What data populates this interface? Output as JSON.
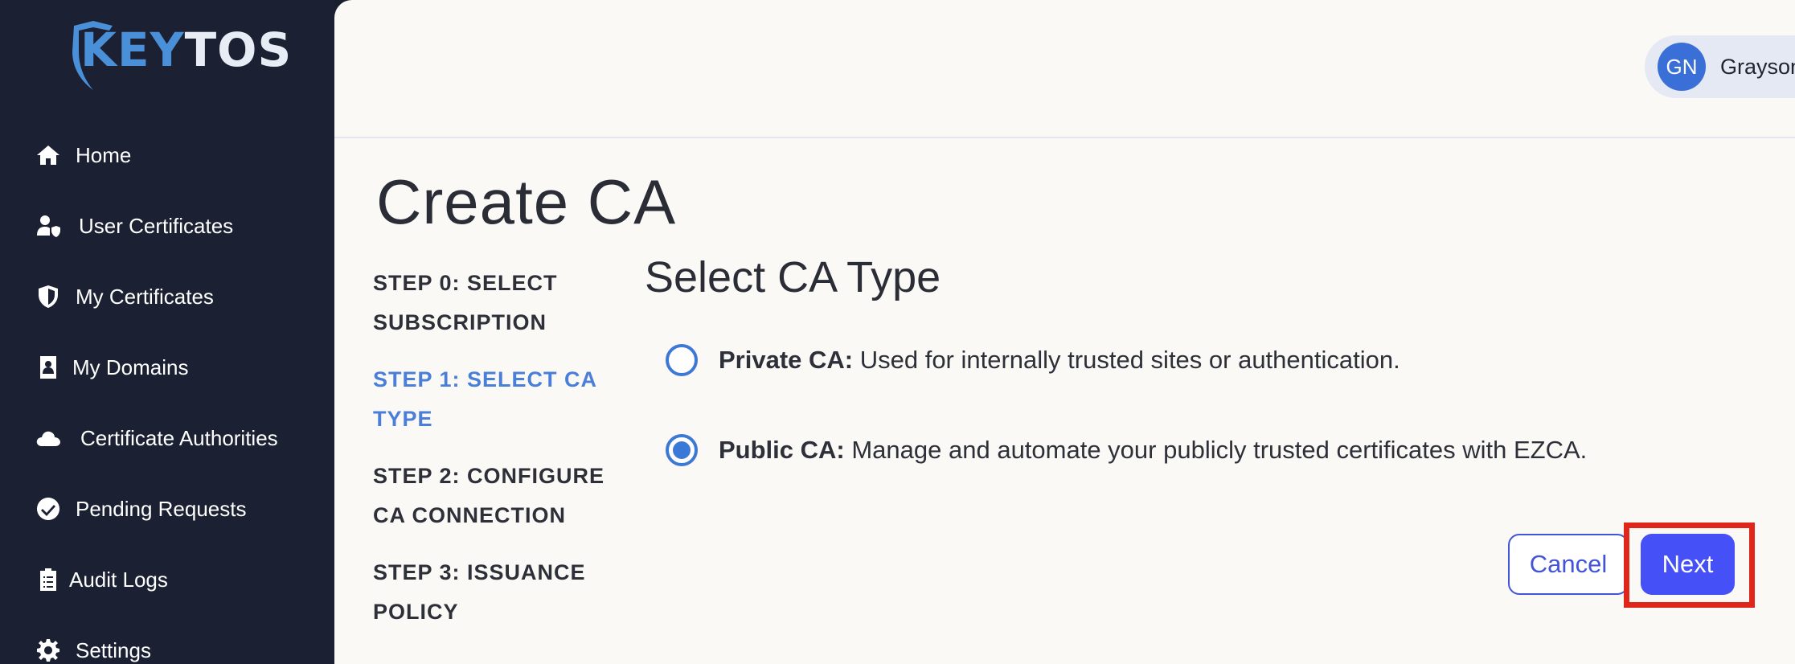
{
  "brand": {
    "logo_key": "KEY",
    "logo_tos": "TOS"
  },
  "sidebar": {
    "items": [
      {
        "label": "Home",
        "icon": "home-icon"
      },
      {
        "label": "User Certificates",
        "icon": "user-shield-icon"
      },
      {
        "label": "My Certificates",
        "icon": "shield-icon"
      },
      {
        "label": "My Domains",
        "icon": "contact-book-icon"
      },
      {
        "label": "Certificate Authorities",
        "icon": "cloud-icon"
      },
      {
        "label": "Pending Requests",
        "icon": "check-circle-icon"
      },
      {
        "label": "Audit Logs",
        "icon": "clipboard-icon"
      },
      {
        "label": "Settings",
        "icon": "gear-icon"
      }
    ]
  },
  "user": {
    "initials": "GN",
    "name": "Grayson"
  },
  "page": {
    "title": "Create CA"
  },
  "steps": [
    {
      "label": "STEP 0: SELECT SUBSCRIPTION",
      "active": false
    },
    {
      "label": "STEP 1: SELECT CA TYPE",
      "active": true
    },
    {
      "label": "STEP 2: CONFIGURE CA CONNECTION",
      "active": false
    },
    {
      "label": "STEP 3: ISSUANCE POLICY",
      "active": false
    }
  ],
  "section": {
    "title": "Select CA Type"
  },
  "options": [
    {
      "label_bold": "Private CA:",
      "label_rest": " Used for internally trusted sites or authentication.",
      "selected": false
    },
    {
      "label_bold": "Public CA:",
      "label_rest": " Manage and automate your publicly trusted certificates with EZCA.",
      "selected": true
    }
  ],
  "actions": {
    "cancel_label": "Cancel",
    "next_label": "Next"
  },
  "colors": {
    "sidebar_bg": "#1b2032",
    "accent_blue": "#4a7fd9",
    "primary_button": "#4551f6",
    "highlight_red": "#e0261b"
  }
}
